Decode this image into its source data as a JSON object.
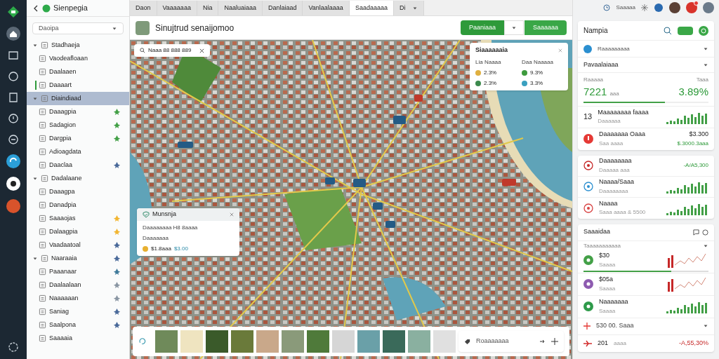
{
  "sidebar": {
    "title": "Sienpegia",
    "dropdown": "Daoipa",
    "groups": [
      {
        "label": "Stadhaeja",
        "expanded": true,
        "selected": false,
        "children": [
          {
            "label": "Vaodeafloaan",
            "accent": false
          },
          {
            "label": "Daalaaen",
            "accent": false
          },
          {
            "label": "Daaaart",
            "accent": true
          }
        ]
      },
      {
        "label": "Diaindiaad",
        "expanded": true,
        "selected": true,
        "children": [
          {
            "label": "Daaagpia",
            "accent": false,
            "color": "#43a047"
          },
          {
            "label": "Sadagion",
            "accent": false,
            "color": "#43a047"
          },
          {
            "label": "Dargpia",
            "accent": false,
            "color": "#43a047"
          },
          {
            "label": "Adioagdata",
            "accent": false
          },
          {
            "label": "Daaclaa",
            "accent": false,
            "color": "#4a6a9a"
          }
        ]
      },
      {
        "label": "Dadalaane",
        "expanded": true,
        "selected": false,
        "children": [
          {
            "label": "Daaagpa",
            "accent": false
          },
          {
            "label": "Danadpia",
            "accent": false
          },
          {
            "label": "Saaaojas",
            "accent": false,
            "color": "#f2b632"
          },
          {
            "label": "Dalaagpia",
            "accent": false,
            "color": "#f2b632"
          },
          {
            "label": "Vaadaatoal",
            "accent": false,
            "color": "#4a6a9a"
          }
        ]
      },
      {
        "label": "Naaraaia",
        "expanded": true,
        "selected": false,
        "color": "#4a6a9a",
        "children": [
          {
            "label": "Paaanaar",
            "accent": false,
            "color": "#3f7a9a"
          },
          {
            "label": "Daalaalaan",
            "accent": false,
            "color": "#8a96a3"
          },
          {
            "label": "Naaaaaan",
            "accent": false,
            "color": "#8a96a3"
          },
          {
            "label": "Saniag",
            "accent": false,
            "color": "#4a6a9a"
          },
          {
            "label": "Saalpona",
            "accent": false,
            "color": "#4a6a9a"
          },
          {
            "label": "Saaaaia",
            "accent": false
          }
        ]
      }
    ]
  },
  "tabs": [
    {
      "label": "Daon",
      "selected": false
    },
    {
      "label": "Vaaaaaaa",
      "selected": false
    },
    {
      "label": "Nia",
      "selected": false
    },
    {
      "label": "Naaluaiaaa",
      "selected": false
    },
    {
      "label": "Danlaiaad",
      "selected": false
    },
    {
      "label": "Vanlaalaaaa",
      "selected": false
    },
    {
      "label": "Saadaaaaa",
      "selected": true
    },
    {
      "label": "Di",
      "selected": false
    }
  ],
  "map_header": {
    "title": "Sinujtrud senaijomoo",
    "buttons": [
      "Paaniaaa",
      "Saaaaaa"
    ]
  },
  "map": {
    "search": "Naaa 88 888 889",
    "legend": {
      "title": "Siaaaaaaia",
      "headers": [
        "Lia Naaaa",
        "Daa Naaaaa"
      ],
      "entries": [
        {
          "value": "2.3%",
          "color": "#e0b040"
        },
        {
          "value": "9.3%",
          "color": "#3d9a3d"
        },
        {
          "value": "2.3%",
          "color": "#3d8a4d"
        },
        {
          "value": "3.3%",
          "color": "#3aa0c0"
        }
      ]
    },
    "popup": {
      "title": "Munsnja",
      "line": "Daaaaaaaa H8 8aaaa",
      "sub": "Daaaaaaa",
      "price": "$1.8aaa",
      "value": "$3.00"
    },
    "filmstrip": {
      "field": "Roaaaaaaa"
    }
  },
  "right": {
    "header": "Saaaaa",
    "card1": {
      "title": "Nampia",
      "row": "Raaaaaaaaa",
      "section": "Pavaalaiaaa",
      "stat": {
        "label": "Raaaaa",
        "value": "7221",
        "unit": "aaa",
        "right_label": "Taaa",
        "right_value": "3.89%",
        "level": 0.65
      },
      "rows": [
        {
          "kind": "number",
          "lead": "13",
          "title": "Maaaaaaaa faaaa",
          "sub": "Daaaaaa",
          "sparkline": {
            "kind": "bars"
          },
          "color": "#43a047"
        },
        {
          "kind": "icon",
          "title": "Daaaaaaa Oaaa",
          "sub": "Saa aaaa",
          "amount": "$3.300",
          "change": "$.3000.3aaa",
          "color": "#e53935"
        }
      ]
    },
    "card2": [
      {
        "title": "Daaaaaaaa",
        "sub": "Daaaaa aaa",
        "change": "-A/A5,300",
        "color": "#c62828"
      },
      {
        "title": "Naaaa/Saaa",
        "sub": "Daaaaaaaa",
        "sparkline": {
          "kind": "bars"
        },
        "color": "#2b8fd0"
      },
      {
        "title": "Naaaa",
        "sub": "Saaa aaaa & 5500",
        "sparkline": {
          "kind": "bars"
        },
        "color": "#d84343"
      }
    ],
    "card3": {
      "title": "Saaaidaa",
      "section": "Taaaaaaaaaaa",
      "rows": [
        {
          "title": "$30",
          "sub": "Saaaa",
          "sparkline": {
            "kind": "mixed"
          },
          "color": "#43a047",
          "level": 0.7
        },
        {
          "title": "$05a",
          "sub": "Saaaa",
          "sparkline": {
            "kind": "mixed"
          },
          "color": "#8e5bb0"
        },
        {
          "title": "Naaaaaaa",
          "sub": "Saaaa",
          "sparkline": {
            "kind": "bars"
          },
          "color": "#2e9a4a"
        }
      ],
      "footer": [
        {
          "title": "530 00. Saaa"
        },
        {
          "title": "201",
          "sub": "aaaa",
          "change": "-A,55,30%"
        }
      ]
    }
  }
}
